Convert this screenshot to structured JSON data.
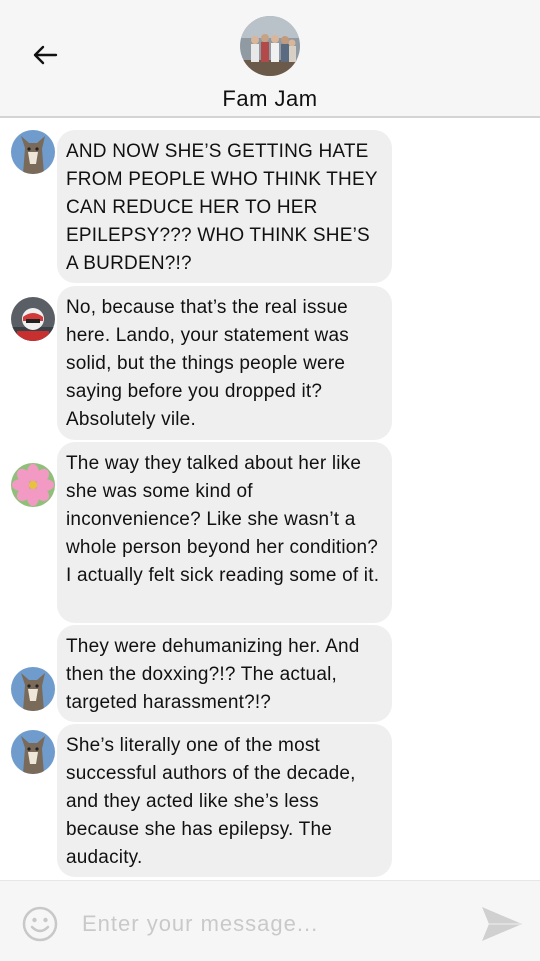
{
  "header": {
    "title": "Fam Jam",
    "back_icon": "arrow-left-icon",
    "avatar": "group-photo"
  },
  "messages": [
    {
      "avatar": "cat-avatar",
      "text": "AND NOW SHE’S GETTING HATE FROM PEOPLE WHO THINK THEY CAN REDUCE HER TO HER EPILEPSY??? WHO THINK SHE’S A BURDEN?!?"
    },
    {
      "avatar": "racing-driver-avatar",
      "text": "No, because that’s the real issue here. Lando, your statement was solid, but the things people were saying before you dropped it? Absolutely vile."
    },
    {
      "avatar": "pink-flower-avatar",
      "text": "The way they talked about her like she was some kind of inconvenience? Like she wasn’t a whole person beyond her condition? I actually felt sick reading some of it."
    },
    {
      "avatar": "cat-avatar",
      "text": "They were dehumanizing her. And then the doxxing?!? The actual, targeted harassment?!?"
    },
    {
      "avatar": "cat-avatar",
      "text": "She’s literally one of the most successful authors of the decade, and they acted like she’s less because she has epilepsy. The audacity."
    }
  ],
  "composer": {
    "placeholder": "Enter your message...",
    "emoji_icon": "smiley-icon",
    "send_icon": "send-icon"
  },
  "colors": {
    "header_bg": "#f6f6f6",
    "bubble_bg": "#efefef",
    "placeholder": "#c9c9c9",
    "send_icon": "#d0d0d0"
  }
}
